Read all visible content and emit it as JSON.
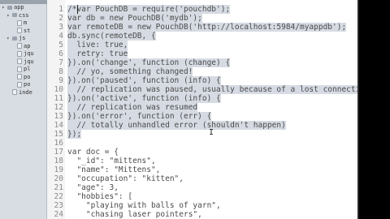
{
  "sidebar": {
    "items": [
      {
        "arrow": "▾",
        "icon": "folder",
        "label": "app"
      },
      {
        "arrow": "▾",
        "icon": "folder",
        "label": "css"
      },
      {
        "arrow": "",
        "icon": "file",
        "label": "m"
      },
      {
        "arrow": "",
        "icon": "file",
        "label": "st"
      },
      {
        "arrow": "▾",
        "icon": "folder",
        "label": "js"
      },
      {
        "arrow": "",
        "icon": "file",
        "label": "ap"
      },
      {
        "arrow": "",
        "icon": "file",
        "label": "jqu"
      },
      {
        "arrow": "",
        "icon": "file",
        "label": "jqu"
      },
      {
        "arrow": "",
        "icon": "file",
        "label": "pl"
      },
      {
        "arrow": "",
        "icon": "file",
        "label": "po"
      },
      {
        "arrow": "",
        "icon": "file",
        "label": "po"
      },
      {
        "arrow": "",
        "icon": "file",
        "label": "inde"
      }
    ]
  },
  "editor": {
    "lines": [
      {
        "n": "1",
        "text": "/*var PouchDB = require('pouchdb');",
        "selected": true
      },
      {
        "n": "2",
        "text": "var db = new PouchDB('mydb');",
        "selected": true
      },
      {
        "n": "3",
        "text": "var remoteDB = new PouchDB('http://localhost:5984/myappdb');",
        "selected": true
      },
      {
        "n": "4",
        "text": "db.sync(remoteDB, {",
        "selected": true
      },
      {
        "n": "5",
        "text": "  live: true,",
        "selected": true
      },
      {
        "n": "6",
        "text": "  retry: true",
        "selected": true
      },
      {
        "n": "7",
        "text": "}).on('change', function (change) {",
        "selected": true
      },
      {
        "n": "8",
        "text": "  // yo, something changed!",
        "selected": true
      },
      {
        "n": "9",
        "text": "}).on('paused', function (info) {",
        "selected": true
      },
      {
        "n": "10",
        "text": "  // replication was paused, usually because of a lost connectio",
        "selected": true
      },
      {
        "n": "11",
        "text": "}).on('active', function (info) {",
        "selected": true
      },
      {
        "n": "12",
        "text": "  // replication was resumed",
        "selected": true
      },
      {
        "n": "13",
        "text": "}).on('error', function (err) {",
        "selected": true
      },
      {
        "n": "14",
        "text": "  // totally unhandled error (shouldn't happen)",
        "selected": true
      },
      {
        "n": "15",
        "text": "});",
        "selected": true
      },
      {
        "n": "16",
        "text": "",
        "selected": false
      },
      {
        "n": "17",
        "text": "var doc = {",
        "selected": false
      },
      {
        "n": "18",
        "text": "  \"_id\": \"mittens\",",
        "selected": false
      },
      {
        "n": "19",
        "text": "  \"name\": \"Mittens\",",
        "selected": false
      },
      {
        "n": "20",
        "text": "  \"occupation\": \"kitten\",",
        "selected": false
      },
      {
        "n": "21",
        "text": "  \"age\": 3,",
        "selected": false
      },
      {
        "n": "22",
        "text": "  \"hobbies\": [",
        "selected": false
      },
      {
        "n": "23",
        "text": "    \"playing with balls of yarn\",",
        "selected": false
      },
      {
        "n": "24",
        "text": "    \"chasing laser pointers\",",
        "selected": false
      }
    ]
  },
  "colors": {
    "selection": "#d6dbe3",
    "gutter": "#f4f4f4",
    "sidebar": "#d8dde3"
  }
}
